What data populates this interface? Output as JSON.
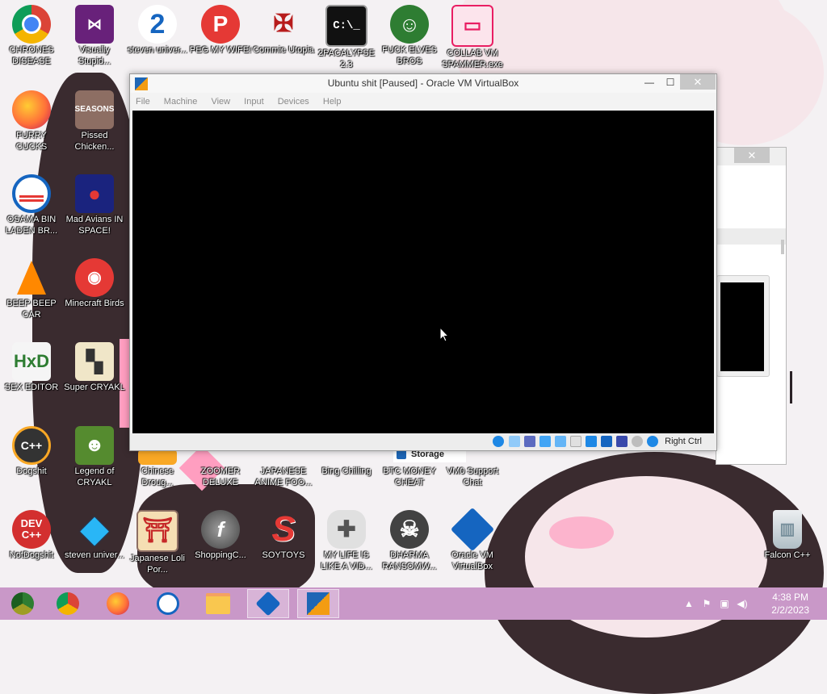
{
  "desktop": {
    "icons": [
      {
        "label": "CHRONES DISEASE",
        "icon": "chrome-icon",
        "color": "#db4437"
      },
      {
        "label": "Visually Stupid...",
        "icon": "visual-studio-icon",
        "color": "#68217a"
      },
      {
        "label": "steven univer...",
        "icon": "number-two-icon",
        "color": "#1565c0"
      },
      {
        "label": "PEG MY WIFE!",
        "icon": "pegasus-icon",
        "color": "#e53935"
      },
      {
        "label": "Commie Utopia",
        "icon": "eagle-emblem-icon",
        "color": "#b71c1c"
      },
      {
        "label": "2PACALYPSE 2.3",
        "icon": "console-icon",
        "color": "#111111"
      },
      {
        "label": "FUCK ELVES BROS",
        "icon": "elf-icon",
        "color": "#2e7d32"
      },
      {
        "label": "COLLAB VM SPAMMER.exe",
        "icon": "monitor-icon",
        "color": "#e91e63"
      },
      {
        "label": "FURRY CUCKS",
        "icon": "firefox-icon",
        "color": "#ff7139"
      },
      {
        "label": "Pissed Chicken...",
        "icon": "angry-birds-seasons-icon",
        "color": "#8d6e63"
      },
      {
        "label": "OSAMA BIN LADEN BR...",
        "icon": "obama-logo-icon",
        "color": "#1565c0"
      },
      {
        "label": "Mad Avians IN SPACE!",
        "icon": "angry-birds-space-icon",
        "color": "#1a237e"
      },
      {
        "label": "BEEP BEEP CAR",
        "icon": "vlc-icon",
        "color": "#ff8800"
      },
      {
        "label": "Minecraft Birds",
        "icon": "angry-bird-icon",
        "color": "#e53935"
      },
      {
        "label": "SEX EDITOR",
        "icon": "hxd-icon",
        "color": "#f5f5f5"
      },
      {
        "label": "Super CRYAKL",
        "icon": "pixel-creature-icon",
        "color": "#f0e6c8"
      },
      {
        "label": "Dogshit",
        "icon": "devcpp-dark-icon",
        "color": "#333333"
      },
      {
        "label": "Legend of CRYAKL",
        "icon": "pixel-hero-icon",
        "color": "#558b2f"
      },
      {
        "label": "Chinese Droug...",
        "icon": "chinese-app-icon",
        "color": "#f9a825"
      },
      {
        "label": "ZOOMER DELUXE",
        "icon": "zoomer-icon",
        "color": "#ff4081"
      },
      {
        "label": "JAPANESE ANIME FOO...",
        "icon": "anime-icon",
        "color": "#ff4081"
      },
      {
        "label": "Bing Chilling",
        "icon": "bing-icon",
        "color": "#00897b"
      },
      {
        "label": "BTC MONEY CHEAT",
        "icon": "bitcoin-icon",
        "color": "#f7931a"
      },
      {
        "label": "VM0 Support Chat",
        "icon": "chat-icon",
        "color": "#5c6bc0"
      },
      {
        "label": "NotDogshit",
        "icon": "devcpp-icon",
        "color": "#d32f2f"
      },
      {
        "label": "steven univer...",
        "icon": "diamond-icon",
        "color": "#29b6f6"
      },
      {
        "label": "Japanese Loli Por...",
        "icon": "torii-icon",
        "color": "#f5deb3"
      },
      {
        "label": "ShoppingC...",
        "icon": "flash-icon",
        "color": "#616161"
      },
      {
        "label": "SOYTOYS",
        "icon": "s-logo-icon",
        "color": "#e53935"
      },
      {
        "label": "MY LIFE IS LIKE A VID...",
        "icon": "gamepad-icon",
        "color": "#e0e0e0"
      },
      {
        "label": "DHARMA RANSOMW...",
        "icon": "skull-icon",
        "color": "#424242"
      },
      {
        "label": "Oracle VM VirtualBox",
        "icon": "virtualbox-icon",
        "color": "#1565c0"
      },
      {
        "label": "Falcon C++",
        "icon": "recycle-bin-icon",
        "color": "#cfd8dc"
      }
    ]
  },
  "vm_window": {
    "title": "Ubuntu shit [Paused] - Oracle VM VirtualBox",
    "controls": {
      "minimize": "—",
      "maximize": "☐",
      "close": "✕"
    },
    "menu": [
      "File",
      "Machine",
      "View",
      "Input",
      "Devices",
      "Help"
    ],
    "status_host_key": "Right Ctrl"
  },
  "back_window": {
    "controls": {
      "maximize": "☐",
      "close": "✕"
    },
    "storage_label": "Storage"
  },
  "taskbar": {
    "pinned": [
      {
        "name": "chrome-alt",
        "icon": "chrome-canary-icon",
        "color": "#2e7d32"
      },
      {
        "name": "chrome",
        "icon": "chrome-icon",
        "color": "#db4437"
      },
      {
        "name": "firefox",
        "icon": "firefox-icon",
        "color": "#ff7139"
      },
      {
        "name": "obama",
        "icon": "obama-logo-icon",
        "color": "#1565c0"
      },
      {
        "name": "explorer",
        "icon": "folder-icon",
        "color": "#f9c74f"
      },
      {
        "name": "virtualbox",
        "icon": "virtualbox-icon",
        "color": "#1565c0"
      },
      {
        "name": "vm-running",
        "icon": "virtualbox-vm-icon",
        "color": "#f39c12"
      }
    ],
    "clock_time": "4:38 PM",
    "clock_date": "2/2/2023"
  }
}
